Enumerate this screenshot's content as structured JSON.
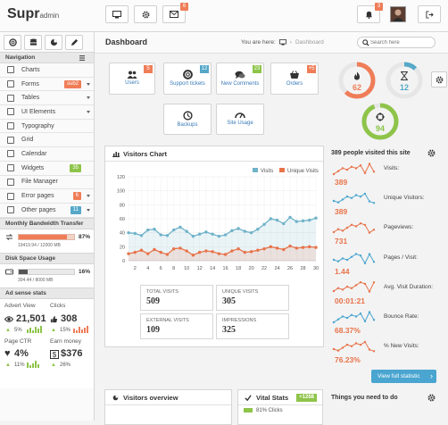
{
  "app": {
    "title": "Supr",
    "subtitle": "admin"
  },
  "topbar": {
    "messages_count": "6",
    "notifications_count": "3"
  },
  "sidebar": {
    "nav_heading": "Navigation",
    "items": [
      {
        "label": "Charts"
      },
      {
        "label": "Forms",
        "badge": "sub2",
        "badge_color": "#ef7d58",
        "caret": true
      },
      {
        "label": "Tables",
        "caret": true
      },
      {
        "label": "UI Elements",
        "caret": true
      },
      {
        "label": "Typography"
      },
      {
        "label": "Grid"
      },
      {
        "label": "Calendar"
      },
      {
        "label": "Widgets",
        "badge": "35",
        "badge_color": "#8ec449"
      },
      {
        "label": "File Manager"
      },
      {
        "label": "Error pages",
        "badge": "6",
        "badge_color": "#ef7d58",
        "caret": true
      },
      {
        "label": "Other pages",
        "badge": "11",
        "badge_color": "#56a8c8",
        "caret": true
      }
    ],
    "bandwidth": {
      "heading": "Monthly Bandwidth Transfer",
      "usage": "19419.94 / 12000 MB",
      "percent": "87%",
      "fraction": 0.87
    },
    "disk": {
      "heading": "Disk Space Usage",
      "usage": "304.44 / 8000 MB",
      "percent": "16%",
      "fraction": 0.16
    },
    "ads": {
      "heading": "Ad sense stats",
      "advert_view_label": "Advert View",
      "advert_view_value": "21,501",
      "advert_view_change": "5%",
      "clicks_label": "Clicks",
      "clicks_value": "308",
      "clicks_change": "15%",
      "page_ctr_label": "Page CTR",
      "page_ctr_value": "4%",
      "page_ctr_change": "11%",
      "earn_label": "Earn money",
      "earn_value": "$376",
      "earn_change": "26%"
    }
  },
  "main": {
    "page_title": "Dashboard",
    "breadcrumb_prefix": "You are here:",
    "breadcrumb_current": "Dashboard",
    "search_placeholder": "Search here",
    "quick_buttons": [
      {
        "label": "Users",
        "badge": "5",
        "badge_color": "#ef7d58"
      },
      {
        "label": "Support tickets",
        "badge": "12",
        "badge_color": "#56a8c8"
      },
      {
        "label": "New Comments",
        "badge": "23",
        "badge_color": "#8ec449"
      },
      {
        "label": "Orders",
        "badge": "+5",
        "badge_color": "#ef7d58"
      },
      {
        "label": "Backups"
      },
      {
        "label": "Site Usage"
      }
    ],
    "circles": [
      {
        "value": "62",
        "fraction": 0.62,
        "color": "#ef7d58"
      },
      {
        "value": "12",
        "fraction": 0.12,
        "color": "#56a8c8"
      },
      {
        "value": "94",
        "fraction": 0.94,
        "color": "#8ec449"
      }
    ],
    "chart_panel_title": "Visitors Chart",
    "stat_boxes": [
      {
        "label": "TOTAL VISITS",
        "value": "509"
      },
      {
        "label": "UNIQUE VISITS",
        "value": "305"
      },
      {
        "label": "EXTERNAL VISITS",
        "value": "109"
      },
      {
        "label": "IMPRESSIONS",
        "value": "325"
      }
    ],
    "right_stats": {
      "title": "389 people visited this site",
      "rows": [
        {
          "label": "Visits:",
          "value": "389"
        },
        {
          "label": "Unique Visitors:",
          "value": "389"
        },
        {
          "label": "Pageviews:",
          "value": "731"
        },
        {
          "label": "Pages / Visit:",
          "value": "1.44"
        },
        {
          "label": "Avg. Visit Duration:",
          "value": "00:01:21"
        },
        {
          "label": "Bounce Rate:",
          "value": "68.37%"
        },
        {
          "label": "% New Visits:",
          "value": "76.23%"
        }
      ],
      "button": "View full statistic"
    },
    "bottom": {
      "visitors_overview": "Visitors overview",
      "vital_stats": "Vital Stats",
      "vital_badge": "+1268",
      "vital_row": "81% Clicks",
      "todo": "Things you need to do"
    }
  },
  "chart_data": {
    "type": "line",
    "legend": [
      "Visits",
      "Unique Visits"
    ],
    "legend_position": "top-right",
    "colors": [
      "#6fb3c9",
      "#e8734a"
    ],
    "x": [
      1,
      2,
      3,
      4,
      5,
      6,
      7,
      8,
      9,
      10,
      11,
      12,
      13,
      14,
      15,
      16,
      17,
      18,
      19,
      20,
      21,
      22,
      23,
      24,
      25,
      26,
      27,
      28,
      29,
      30
    ],
    "xticks": [
      2,
      4,
      6,
      8,
      10,
      12,
      14,
      16,
      18,
      20,
      22,
      24,
      26,
      28,
      30
    ],
    "series": [
      {
        "name": "Visits",
        "values": [
          40,
          39,
          36,
          44,
          45,
          37,
          36,
          44,
          48,
          42,
          35,
          38,
          41,
          38,
          35,
          37,
          43,
          46,
          42,
          40,
          45,
          52,
          60,
          58,
          53,
          62,
          56,
          57,
          58,
          61
        ]
      },
      {
        "name": "Unique Visits",
        "values": [
          10,
          12,
          15,
          10,
          16,
          12,
          9,
          17,
          18,
          14,
          8,
          12,
          14,
          13,
          10,
          9,
          14,
          17,
          12,
          13,
          15,
          17,
          20,
          18,
          16,
          21,
          18,
          19,
          20,
          19
        ]
      }
    ],
    "yticks": [
      0,
      20,
      40,
      60,
      80,
      100,
      120
    ],
    "ylim": [
      0,
      120
    ],
    "grid": true
  }
}
